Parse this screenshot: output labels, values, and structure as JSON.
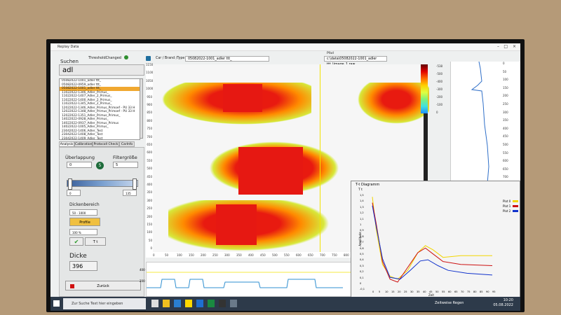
{
  "window": {
    "title": "Replay Data"
  },
  "header": {
    "threshold_label": "ThresholdChanged",
    "breadcrumb": "Car / Brand /Type /",
    "current_type": "05082022-1001_adler ttt_",
    "pfad_label": "Pfad",
    "path_value": "c:\\data\\05082022-1001_adler ttt_\\image_1.raw"
  },
  "sidebar": {
    "search_label": "Suchen",
    "search_value": "adl",
    "items": [
      "05082022-1001_adler ttt_",
      "05082022-0959_adler ttt_",
      "05082022-1001_adler ttt_",
      "11022022-1346_Adler_Primus_",
      "11022022-1407_Adler_2_Primus_",
      "11022022-1400_Adler_2_Primus_",
      "11022022-1345_Adler_2_Primus_",
      "12022022-1346_Adler_Primus_Primoef - PU 33 H",
      "12022022-1348_Adler_Primus_Primoef - PU 33 H",
      "12022022-1351_Adler_Primus_Primus_",
      "14022022-0928_Adler_Primus_",
      "14022022-0937_Adler_Primus_Primus",
      "14022022-1005_Adler_Primus_",
      "23042022-1406_Adler_Test",
      "23042022-1408_Adler_Test",
      "23042022-1409_Adler_Test"
    ],
    "selected_index": 2,
    "tabs": [
      "Analysis",
      "Calibration",
      "Protocoll Check",
      "CarInfo"
    ],
    "ueberlappung_label": "Überlappung",
    "ueberlappung_value": "0",
    "filtergroesse_label": "Filtergröße",
    "filtergroesse_value": "5",
    "step_badge": "5",
    "slider_min": "0",
    "slider_max": "135",
    "dickenbereich_label": "Dickenbereich",
    "dickenbereich_value": "50 - 1000",
    "profile_button": "Profile",
    "percent_value": "100 %",
    "t_label": "T t",
    "dicke_label": "Dicke",
    "dicke_value": "396",
    "zurueck_button": "Zurück"
  },
  "main_plot": {
    "y_ticks": [
      "1150",
      "1100",
      "1050",
      "1000",
      "950",
      "900",
      "850",
      "800",
      "750",
      "700",
      "650",
      "600",
      "550",
      "500",
      "450",
      "400",
      "350",
      "300",
      "250",
      "200",
      "150",
      "100",
      "50",
      "0"
    ],
    "x_ticks": [
      "0",
      "50",
      "100",
      "150",
      "200",
      "250",
      "300",
      "350",
      "400",
      "450",
      "500",
      "550",
      "600",
      "650",
      "700",
      "750",
      "800",
      "850",
      "900",
      "950",
      "1000",
      "1050",
      "1100"
    ],
    "colorscale_ticks": [
      "-538",
      "-500",
      "-400",
      "-300",
      "-200",
      "-100",
      "0"
    ],
    "bottom_ticks": [
      "400",
      "200"
    ]
  },
  "profile_plot": {
    "y_ticks": [
      "0",
      "50",
      "100",
      "150",
      "200",
      "250",
      "300",
      "350",
      "400",
      "450",
      "500",
      "550",
      "600",
      "650",
      "700"
    ]
  },
  "graph": {
    "title": "T-t Diagramm",
    "y_axis_title": "T t",
    "y_label": "Amplitude",
    "x_label": "Zeit",
    "y_ticks": [
      "1,5",
      "1,4",
      "1,3",
      "1,2",
      "1,1",
      "1",
      "0,9",
      "0,8",
      "0,7",
      "0,6",
      "0,5",
      "0,4",
      "0,3",
      "0,2",
      "0,1",
      "0",
      "-0,1"
    ],
    "x_ticks": [
      "0",
      "5",
      "10",
      "15",
      "20",
      "25",
      "30",
      "35",
      "40",
      "45",
      "50",
      "55",
      "60",
      "65",
      "70",
      "75",
      "80",
      "85",
      "90",
      "95"
    ],
    "legend": [
      "Plot 0",
      "Plot 1",
      "Plot 2"
    ],
    "colors": [
      "#f2d600",
      "#cc1111",
      "#1133cc"
    ]
  },
  "taskbar": {
    "search_placeholder": "Zur Suche Text hier eingeben",
    "weather": "Zeitweise Regen",
    "time": "10:20",
    "date": "05.08.2022"
  }
}
